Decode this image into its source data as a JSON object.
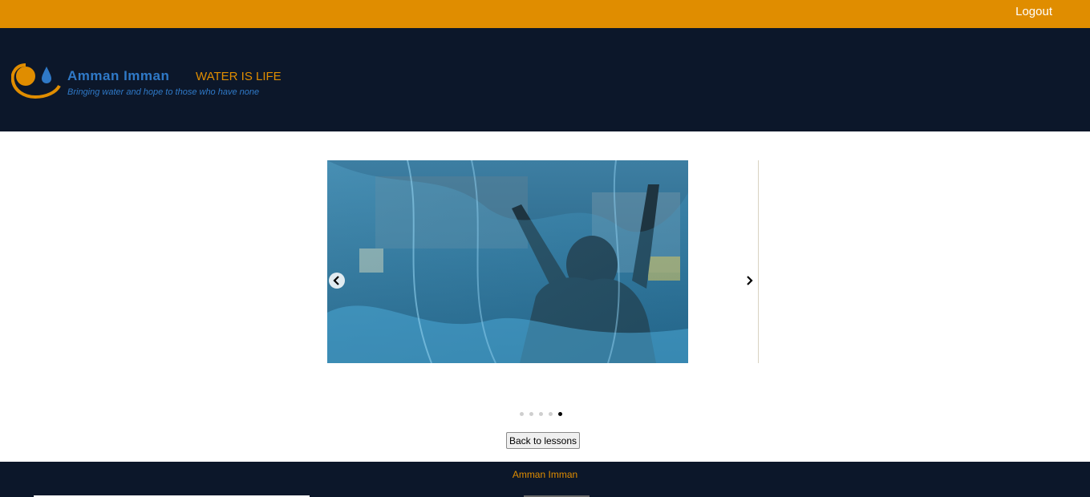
{
  "topbar": {
    "logout_label": "Logout"
  },
  "header": {
    "brand_name": "Amman Imman",
    "tagline_main": "WATER IS LIFE",
    "tagline_sub": "Bringing water and hope to those who have none"
  },
  "carousel": {
    "prev_icon": "chevron-left-icon",
    "next_icon": "chevron-right-icon",
    "slide_count": 5,
    "active_slide": 5
  },
  "actions": {
    "back_label": "Back to lessons"
  },
  "footer": {
    "text": "Amman Imman"
  },
  "colors": {
    "accent": "#e08d00",
    "header_bg": "#0c172a",
    "brand_blue": "#2f79c7"
  }
}
